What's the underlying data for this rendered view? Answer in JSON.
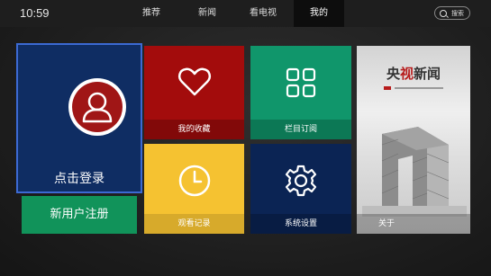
{
  "status": {
    "time": "10:59"
  },
  "nav": {
    "tabs": [
      {
        "label": "推荐"
      },
      {
        "label": "新闻"
      },
      {
        "label": "看电视"
      },
      {
        "label": "我的",
        "active": true
      }
    ],
    "search_label": "搜索"
  },
  "tiles": {
    "login": {
      "label": "点击登录",
      "icon": "user-avatar-icon"
    },
    "register": {
      "label": "新用户注册"
    },
    "favorites": {
      "label": "我的收藏",
      "icon": "heart-icon"
    },
    "subscriptions": {
      "label": "栏目订阅",
      "icon": "grid-icon"
    },
    "history": {
      "label": "观看记录",
      "icon": "clock-icon"
    },
    "settings": {
      "label": "系统设置",
      "icon": "gear-icon"
    },
    "about": {
      "label": "关于",
      "brand_black": "央",
      "brand_red": "视",
      "brand_rest": "新闻"
    }
  },
  "colors": {
    "login_bg": "#0f2d63",
    "register_bg": "#11935a",
    "favorites_bg": "#a30c0c",
    "subscriptions_bg": "#10966b",
    "history_bg": "#f5c231",
    "settings_bg": "#0b2454"
  }
}
